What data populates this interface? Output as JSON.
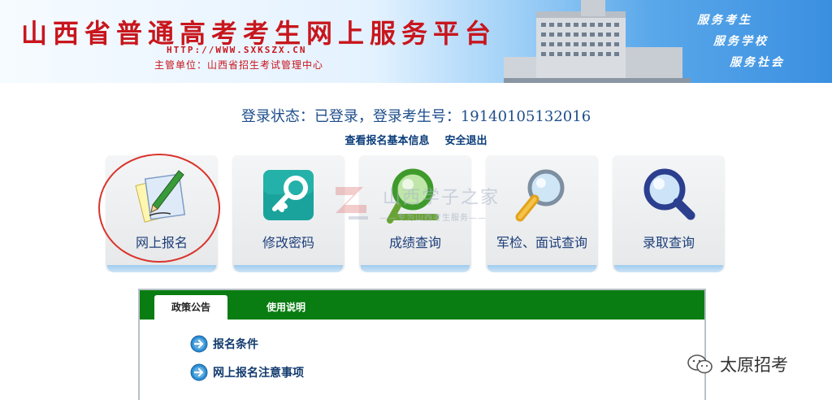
{
  "header": {
    "title": "山西省普通高考考生网上服务平台",
    "url": "HTTP://WWW.SXKSZX.CN",
    "org": "主管单位：山西省招生考试管理中心",
    "slogans": [
      "服务考生",
      "服务学校",
      "服务社会"
    ]
  },
  "login": {
    "status": "登录状态：已登录，登录考生号：19140105132016",
    "links": [
      "查看报名基本信息",
      "安全退出"
    ]
  },
  "tiles": [
    {
      "label": "网上报名",
      "icon": "pencil-paper-icon"
    },
    {
      "label": "修改密码",
      "icon": "key-icon"
    },
    {
      "label": "成绩查询",
      "icon": "magnifier-green-icon"
    },
    {
      "label": "军检、面试查询",
      "icon": "magnifier-yellow-icon"
    },
    {
      "label": "录取查询",
      "icon": "magnifier-blue-icon"
    }
  ],
  "watermark": {
    "text": "山西学子之家",
    "sub": "——专为山西考生服务——"
  },
  "notice": {
    "tabs": [
      "政策公告",
      "使用说明"
    ],
    "items": [
      "报名条件",
      "网上报名注意事项"
    ]
  },
  "wechat": {
    "account": "太原招考"
  },
  "colors": {
    "title_red": "#c8161d",
    "tab_green": "#0a7d12",
    "text_blue": "#1f4e8c"
  }
}
